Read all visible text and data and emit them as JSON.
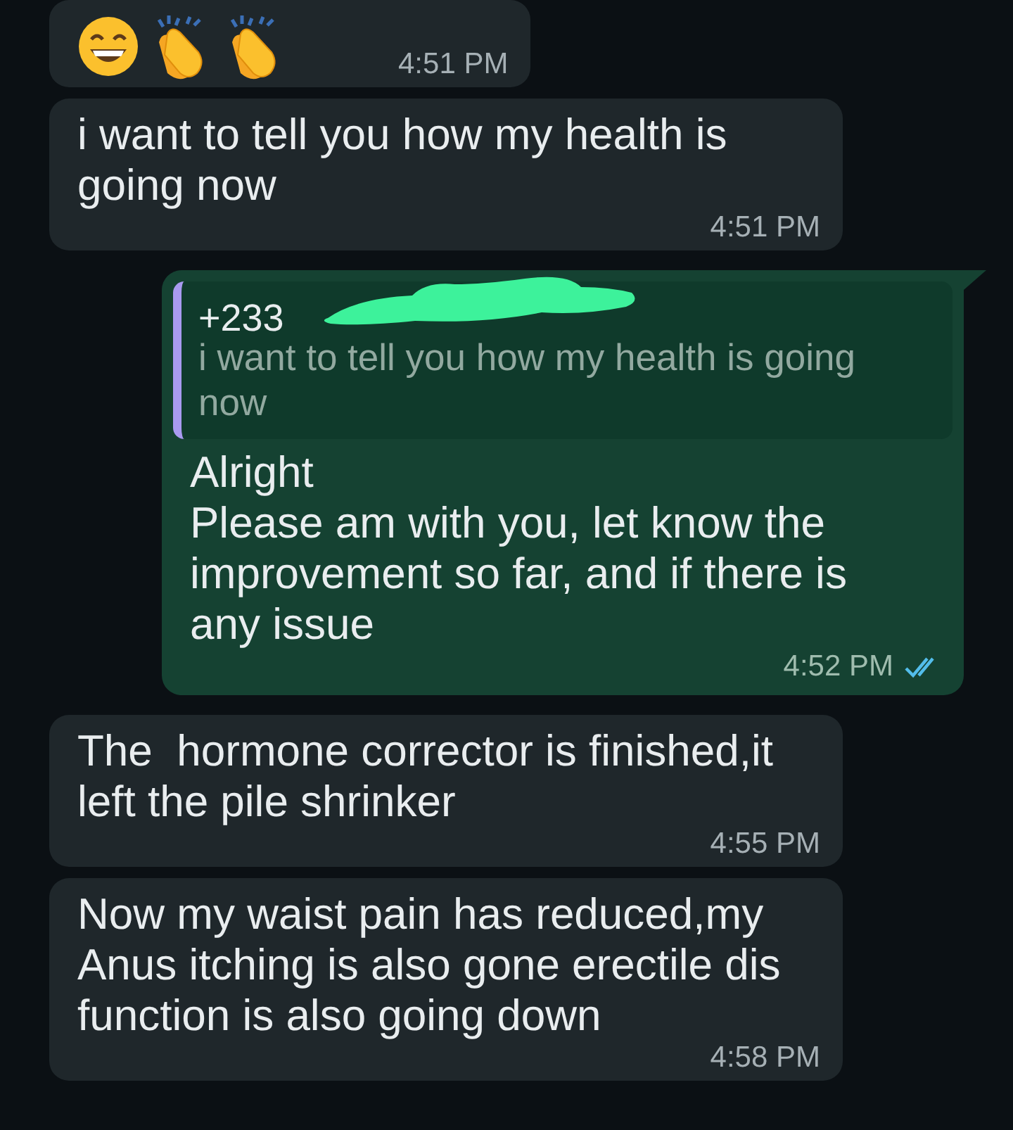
{
  "messages": [
    {
      "outgoing": false,
      "kind": "emoji",
      "emojis": [
        {
          "kind": "grin"
        },
        {
          "kind": "clap"
        },
        {
          "kind": "clap"
        }
      ],
      "time": "4:51 PM"
    },
    {
      "outgoing": false,
      "kind": "text",
      "text": "i want to tell you how my health is going now",
      "time": "4:51 PM"
    },
    {
      "outgoing": true,
      "kind": "reply",
      "quote": {
        "sender": "+233",
        "text": "i want to tell you how my health is going now",
        "redacted": true
      },
      "text": "Alright\nPlease am with you, let know the improvement so far, and if there is any issue",
      "time": "4:52 PM",
      "read": true
    },
    {
      "outgoing": false,
      "kind": "text",
      "text": "The  hormone corrector is finished,it left the pile shrinker",
      "time": "4:55 PM"
    },
    {
      "outgoing": false,
      "kind": "text",
      "text": "Now my waist pain has reduced,my Anus itching is also gone erectile dis function is also going down",
      "time": "4:58 PM"
    }
  ]
}
